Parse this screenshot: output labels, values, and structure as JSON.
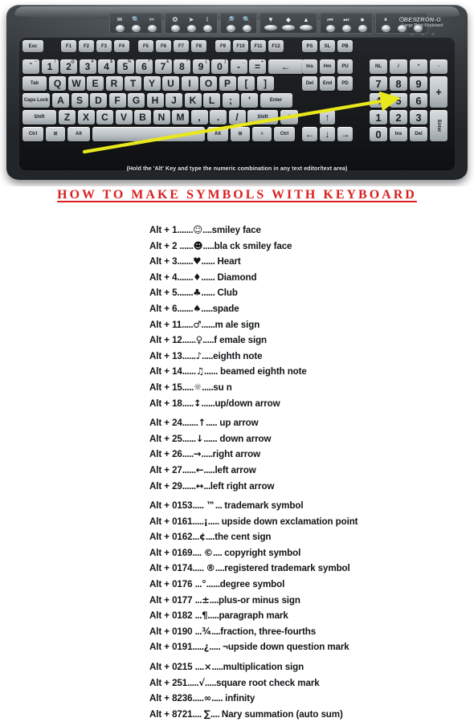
{
  "title": "HOW  TO  MAKE  SYMBOLS  WITH  KEYBOARD",
  "colors": {
    "title_red": "#d91f1f",
    "arrow_yellow": "#e8e81c",
    "page_bg": "#ffffff",
    "key_dark": "#22262a",
    "key_light": "#c3c9cd"
  },
  "keyboard": {
    "brand_name": "BESTRON-G",
    "brand_sub": "Large Print Keyboard",
    "caption": "(Hold the 'Alt' Key and type the numeric combination in any text editor/text area)",
    "hotkey_groups": [
      {
        "icons": [
          "email-icon",
          "search-icon",
          "tools-icon"
        ]
      },
      {
        "icons": [
          "browser-icon",
          "cursor-icon",
          "text-cursor-icon"
        ]
      },
      {
        "icons": [
          "zoom-in-icon",
          "zoom-out-icon"
        ]
      },
      {
        "icons": [
          "volume-up-icon",
          "volume-mute-icon",
          "volume-down-icon"
        ]
      },
      {
        "icons": [
          "media-prev-icon",
          "media-next-icon",
          "media-stop-icon"
        ]
      },
      {
        "icons": [
          "media-pause-icon",
          "power-icon",
          "sleep-icon"
        ]
      }
    ],
    "function_row": {
      "esc": "Esc",
      "group1": [
        "F1",
        "F2",
        "F3",
        "F4"
      ],
      "group2": [
        "F5",
        "F6",
        "F7",
        "F8"
      ],
      "group3": [
        "F9",
        "F10",
        "F11",
        "F12"
      ],
      "group4": [
        "PS",
        "SL",
        "PB"
      ]
    },
    "number_row": [
      {
        "main": "`",
        "sup": "~"
      },
      {
        "main": "1",
        "sup": "!"
      },
      {
        "main": "2",
        "sup": "@"
      },
      {
        "main": "3",
        "sup": "#"
      },
      {
        "main": "4",
        "sup": "$"
      },
      {
        "main": "5",
        "sup": "%"
      },
      {
        "main": "6",
        "sup": "^"
      },
      {
        "main": "7",
        "sup": "&"
      },
      {
        "main": "8",
        "sup": "*"
      },
      {
        "main": "9",
        "sup": "("
      },
      {
        "main": "0",
        "sup": ")"
      },
      {
        "main": "-",
        "sup": "_"
      },
      {
        "main": "=",
        "sup": "+"
      }
    ],
    "backspace": "←",
    "row_q": {
      "tab": "Tab",
      "keys": [
        "Q",
        "W",
        "E",
        "R",
        "T",
        "Y",
        "U",
        "I",
        "O",
        "P",
        "[",
        "]"
      ]
    },
    "row_a": {
      "caps": "Caps Lock",
      "keys": [
        "A",
        "S",
        "D",
        "F",
        "G",
        "H",
        "J",
        "K",
        "L",
        ";",
        "'"
      ],
      "enter": "Enter"
    },
    "row_z": {
      "shift_l": "Shift",
      "keys": [
        "Z",
        "X",
        "C",
        "V",
        "B",
        "N",
        "M",
        ",",
        ".",
        "/"
      ],
      "shift_r": "Shift",
      "backslash": "\\"
    },
    "row_bottom": {
      "ctrl_l": "Ctrl",
      "win_l": "win-icon",
      "alt_l": "Alt",
      "space": "",
      "alt_r": "Alt",
      "win_r": "win-icon",
      "menu": "menu-icon",
      "ctrl_r": "Ctrl"
    },
    "nav_cluster": {
      "row1": [
        "Ins",
        "Hm",
        "PU"
      ],
      "row2": [
        "Del",
        "End",
        "PD"
      ]
    },
    "arrows": {
      "up": "↑",
      "left": "←",
      "down": "↓",
      "right": "→"
    },
    "numpad": {
      "row1": [
        "NL",
        "/",
        "*",
        "-"
      ],
      "row2": [
        "7",
        "8",
        "9"
      ],
      "row3": [
        "4",
        "5",
        "6"
      ],
      "row4": [
        "1",
        "2",
        "3"
      ],
      "row5": [
        "0",
        "Ins",
        "Del"
      ],
      "plus": "+",
      "enter": "Enter"
    }
  },
  "symbol_list": [
    {
      "combo": "Alt + 1",
      "dots1": ".......",
      "sym": "☺",
      "dots2": "....",
      "desc": "smiley face",
      "gap": false
    },
    {
      "combo": "Alt + 2 ",
      "dots1": "......",
      "sym": "☻",
      "dots2": ".....",
      "desc": "bla ck smiley face",
      "gap": false
    },
    {
      "combo": "Alt + 3",
      "dots1": ".......",
      "sym": "♥",
      "dots2": "......",
      "desc": " Heart",
      "gap": false
    },
    {
      "combo": "Alt + 4",
      "dots1": ".......",
      "sym": "♦",
      "dots2": "......",
      "desc": " Diamond",
      "gap": false
    },
    {
      "combo": "Alt + 5",
      "dots1": ".......",
      "sym": "♣",
      "dots2": "......",
      "desc": " Club",
      "gap": false
    },
    {
      "combo": "Alt + 6",
      "dots1": ".......",
      "sym": "♠",
      "dots2": ".....",
      "desc": "spade",
      "gap": false
    },
    {
      "combo": "Alt + 11",
      "dots1": ".....",
      "sym": "♂",
      "dots2": "......",
      "desc": "m ale sign",
      "gap": false
    },
    {
      "combo": "Alt + 12",
      "dots1": "......",
      "sym": "♀",
      "dots2": ".....",
      "desc": "f emale sign",
      "gap": false
    },
    {
      "combo": "Alt + 13",
      "dots1": "......",
      "sym": "♪",
      "dots2": ".....",
      "desc": "eighth note",
      "gap": false
    },
    {
      "combo": "Alt + 14",
      "dots1": "......",
      "sym": "♫",
      "dots2": "......",
      "desc": " beamed eighth note",
      "gap": false
    },
    {
      "combo": "Alt + 15",
      "dots1": ".....",
      "sym": "☼",
      "dots2": ".....",
      "desc": "su n",
      "gap": false
    },
    {
      "combo": "Alt + 18",
      "dots1": ".....",
      "sym": "↕",
      "dots2": "......",
      "desc": "up/down arrow",
      "gap": false
    },
    {
      "combo": "Alt + 24",
      "dots1": ".......",
      "sym": "↑",
      "dots2": ".....",
      "desc": " up arrow",
      "gap": true
    },
    {
      "combo": "Alt + 25",
      "dots1": "......",
      "sym": "↓",
      "dots2": "......",
      "desc": " down arrow",
      "gap": false
    },
    {
      "combo": "Alt + 26",
      "dots1": ".....",
      "sym": "→",
      "dots2": ".....",
      "desc": "right arrow",
      "gap": false
    },
    {
      "combo": "Alt + 27",
      "dots1": "......",
      "sym": "←",
      "dots2": ".....",
      "desc": "left arrow",
      "gap": false
    },
    {
      "combo": "Alt + 29",
      "dots1": "......",
      "sym": "↔",
      "dots2": "...",
      "desc": "left right arrow",
      "gap": false
    },
    {
      "combo": "Alt + 0153",
      "dots1": "..... ",
      "sym": "™",
      "dots2": "... ",
      "desc": "trademark symbol",
      "gap": true
    },
    {
      "combo": "Alt + 0161",
      "dots1": ".....",
      "sym": "¡",
      "dots2": "..... ",
      "desc": "upside down exclamation point",
      "gap": false
    },
    {
      "combo": "Alt + 0162",
      "dots1": "...",
      "sym": "¢",
      "dots2": "....",
      "desc": "the cent sign",
      "gap": false
    },
    {
      "combo": "Alt + 0169",
      "dots1": ".... ",
      "sym": "©",
      "dots2": ".... ",
      "desc": "copyright symbol",
      "gap": false
    },
    {
      "combo": "Alt + 0174",
      "dots1": "..... ",
      "sym": "®",
      "dots2": "....",
      "desc": "registered  trademark symbol",
      "gap": false
    },
    {
      "combo": "Alt + 0176 ",
      "dots1": "...",
      "sym": "°",
      "dots2": "......",
      "desc": "degree symbol",
      "gap": false
    },
    {
      "combo": "Alt + 0177 ",
      "dots1": "...",
      "sym": "±",
      "dots2": "....",
      "desc": "plus-or minus sign",
      "gap": false
    },
    {
      "combo": "Alt + 0182 ",
      "dots1": "...",
      "sym": "¶",
      "dots2": ".....",
      "desc": "paragraph mark",
      "gap": false
    },
    {
      "combo": "Alt + 0190 ",
      "dots1": "...",
      "sym": "¾",
      "dots2": "....",
      "desc": "fraction, three-fourths",
      "gap": false
    },
    {
      "combo": "Alt + 0191",
      "dots1": ".....",
      "sym": "¿",
      "dots2": "..... ",
      "desc": "¬upside down question mark",
      "gap": false
    },
    {
      "combo": "Alt + 0215 ",
      "dots1": "....",
      "sym": "×",
      "dots2": ".....",
      "desc": "multiplication sign",
      "gap": true
    },
    {
      "combo": "Alt + 251",
      "dots1": ".....",
      "sym": "√",
      "dots2": ".....",
      "desc": "square root check mark",
      "gap": false
    },
    {
      "combo": "Alt + 8236",
      "dots1": ".....",
      "sym": "∞",
      "dots2": "..... ",
      "desc": "infinity",
      "gap": false
    },
    {
      "combo": "Alt + 8721",
      "dots1": ".... ",
      "sym": "∑",
      "dots2": ".... ",
      "desc": "Nary summation (auto sum)",
      "gap": false
    }
  ]
}
